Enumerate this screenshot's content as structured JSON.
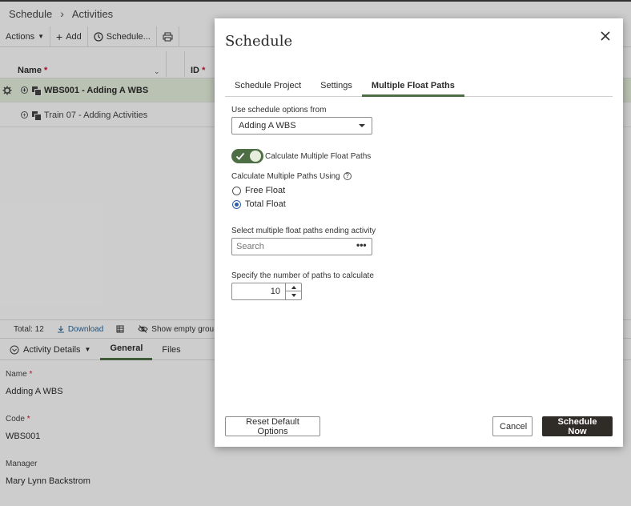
{
  "app": {
    "breadcrumb": [
      "Schedule",
      "Activities"
    ],
    "toolbar": {
      "actions_label": "Actions",
      "add_label": "Add",
      "schedule_label": "Schedule..."
    },
    "grid": {
      "col_name": "Name",
      "col_id": "ID",
      "rows": [
        {
          "label": "WBS001 - Adding A WBS"
        },
        {
          "label": "Train 07 - Adding Activities"
        }
      ]
    },
    "footer": {
      "total": "Total: 12",
      "download": "Download",
      "show_empty": "Show empty grou"
    },
    "details": {
      "header": "Activity Details",
      "tabs": [
        "General",
        "Files"
      ],
      "fields": [
        {
          "label": "Name",
          "value": "Adding A WBS"
        },
        {
          "label": "Code",
          "value": "WBS001"
        },
        {
          "label": "Manager",
          "value": "Mary Lynn Backstrom"
        }
      ]
    }
  },
  "dialog": {
    "title": "Schedule",
    "tabs": [
      {
        "label": "Schedule Project",
        "active": false
      },
      {
        "label": "Settings",
        "active": false
      },
      {
        "label": "Multiple Float Paths",
        "active": true
      }
    ],
    "use_options_label": "Use schedule options from",
    "use_options_value": "Adding A WBS",
    "toggle_label": "Calculate Multiple Float Paths",
    "toggle_on": true,
    "paths_using_label": "Calculate Multiple Paths Using",
    "radio": [
      {
        "label": "Free Float",
        "checked": false
      },
      {
        "label": "Total Float",
        "checked": true
      }
    ],
    "ending_activity_label": "Select multiple float paths ending activity",
    "search_placeholder": "Search",
    "num_paths_label": "Specify the number of paths to calculate",
    "num_paths_value": "10",
    "buttons": {
      "reset": "Reset Default Options",
      "cancel": "Cancel",
      "schedule_now": "Schedule Now"
    }
  },
  "colors": {
    "accent_green": "#4e6f45",
    "primary_button": "#2f2b27",
    "radio_blue": "#2b5fa8",
    "selected_row": "#e3eddb"
  }
}
